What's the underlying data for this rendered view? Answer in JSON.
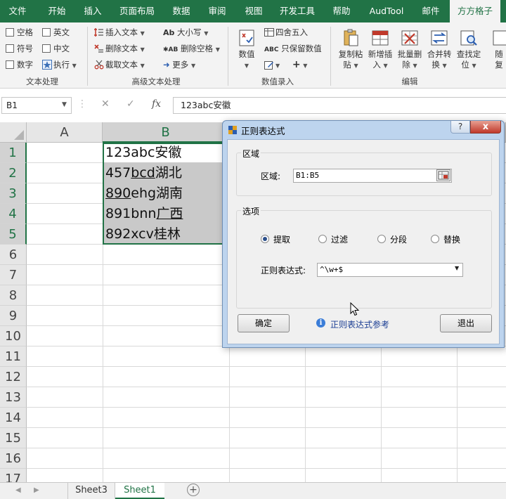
{
  "ribbon_tabs": [
    "文件",
    "开始",
    "插入",
    "页面布局",
    "数据",
    "审阅",
    "视图",
    "开发工具",
    "帮助",
    "AudTool",
    "邮件",
    "方方格子"
  ],
  "active_tab": "方方格子",
  "text_group": {
    "checkboxes": [
      "空格",
      "英文",
      "符号",
      "中文",
      "数字"
    ],
    "execute": "执行",
    "label": "文本处理"
  },
  "advanced_text": {
    "insert": "插入文本",
    "delete": "删除文本",
    "truncate": "截取文本",
    "case": "大小写",
    "delete_space": "删除空格",
    "more": "更多",
    "label": "高级文本处理"
  },
  "numeric_entry": {
    "numeric": "数值",
    "round": "四舍五入",
    "keep_numeric": "只保留数值",
    "label": "数值录入"
  },
  "edit_group": {
    "copy_paste": [
      "复制粘",
      "贴"
    ],
    "insert_new": [
      "新增插",
      "入"
    ],
    "batch_delete": [
      "批量删",
      "除"
    ],
    "merge_convert": [
      "合并转",
      "换"
    ],
    "find_locate": [
      "查找定",
      "位"
    ],
    "random": [
      "随",
      "复"
    ],
    "label": "编辑"
  },
  "formula_bar": {
    "name_box": "B1",
    "fx": "fx",
    "content": "123abc安徽"
  },
  "columns": [
    "A",
    "B"
  ],
  "rows": [
    "1",
    "2",
    "3",
    "4",
    "5",
    "6",
    "7",
    "8",
    "9",
    "10",
    "11",
    "12",
    "13",
    "14",
    "15",
    "16",
    "17"
  ],
  "cells": [
    {
      "pre": "123abc安徽",
      "u": "",
      "post": ""
    },
    {
      "pre": "457",
      "u": "bcd",
      "post": "湖北"
    },
    {
      "pre": "",
      "u": "890",
      "post": "ehg湖南"
    },
    {
      "pre": "891bnn",
      "u": "广西",
      "post": ""
    },
    {
      "pre": "892xcv桂林",
      "u": "",
      "post": ""
    }
  ],
  "sheet_tabs": [
    "Sheet3",
    "Sheet1"
  ],
  "active_sheet": "Sheet1",
  "dialog": {
    "title": "正则表达式",
    "help": "?",
    "close": "x",
    "area_group": "区域",
    "area_label": "区域:",
    "area_value": "B1:B5",
    "options_group": "选项",
    "radios": [
      "提取",
      "过滤",
      "分段",
      "替换"
    ],
    "selected_radio": "提取",
    "regex_label": "正则表达式:",
    "regex_value": "^\\w+$",
    "ok": "确定",
    "reference_link": "正则表达式参考",
    "exit": "退出"
  }
}
